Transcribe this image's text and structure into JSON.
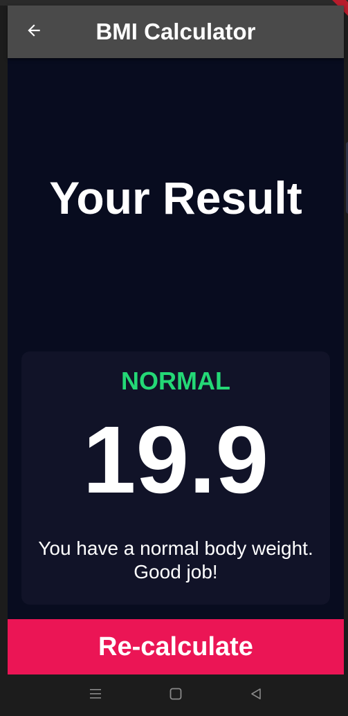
{
  "app_bar": {
    "title": "BMI Calculator",
    "back_icon": "arrow-back-icon"
  },
  "result": {
    "heading": "Your Result",
    "category": "NORMAL",
    "bmi": "19.9",
    "interpretation": "You have a normal body weight. Good job!"
  },
  "actions": {
    "recalculate_label": "Re-calculate"
  },
  "system_nav": {
    "recents_icon": "menu-icon",
    "home_icon": "home-square-icon",
    "back_icon": "back-triangle-icon"
  },
  "colors": {
    "background": "#080c1f",
    "card": "#111328",
    "app_bar": "#4a4a4a",
    "category_green": "#24d876",
    "button_pink": "#eb1555"
  }
}
